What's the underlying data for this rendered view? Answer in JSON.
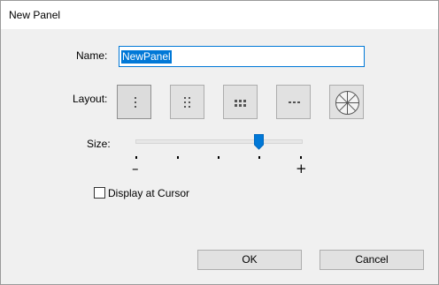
{
  "window": {
    "title": "New Panel"
  },
  "form": {
    "name_label": "Name:",
    "name_value": "NewPanel",
    "layout_label": "Layout:",
    "layout_options": [
      "single-column-icon",
      "two-column-icon",
      "three-column-icon",
      "horizontal-icon",
      "pie-icon"
    ],
    "layout_selected": "single-column-icon",
    "size_label": "Size:",
    "size_min_label": "–",
    "size_max_label": "+",
    "size_value": 0.74,
    "size_tick_count": 5,
    "display_at_cursor_label": "Display at Cursor",
    "display_at_cursor_checked": false
  },
  "buttons": {
    "ok_label": "OK",
    "cancel_label": "Cancel"
  },
  "colors": {
    "accent": "#0078d7",
    "window_bg": "#f0f0f0",
    "button_bg": "#e1e1e1"
  }
}
